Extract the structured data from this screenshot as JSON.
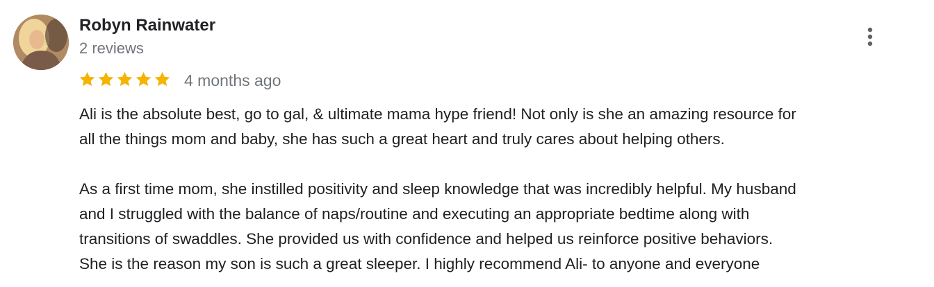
{
  "review": {
    "author": "Robyn Rainwater",
    "review_count": "2 reviews",
    "rating": 5,
    "rating_max": 5,
    "star_color": "#F4B400",
    "time_ago": "4 months ago",
    "more_icon": "more-vert-icon",
    "paragraphs": [
      [
        "Ali is the absolute best, go to gal, & ultimate mama hype friend! Not only is she an amazing resource for",
        "all the things mom and baby, she has such a great heart and truly cares about helping others."
      ],
      [
        "As a first time mom, she instilled positivity and sleep knowledge that was incredibly helpful. My husband",
        "and I struggled with the balance of naps/routine and executing an appropriate bedtime along with",
        "transitions of swaddles. She provided us with confidence and helped us reinforce positive behaviors.",
        "She is the reason my son is such a great sleeper. I highly recommend Ali- to anyone and everyone"
      ]
    ]
  }
}
